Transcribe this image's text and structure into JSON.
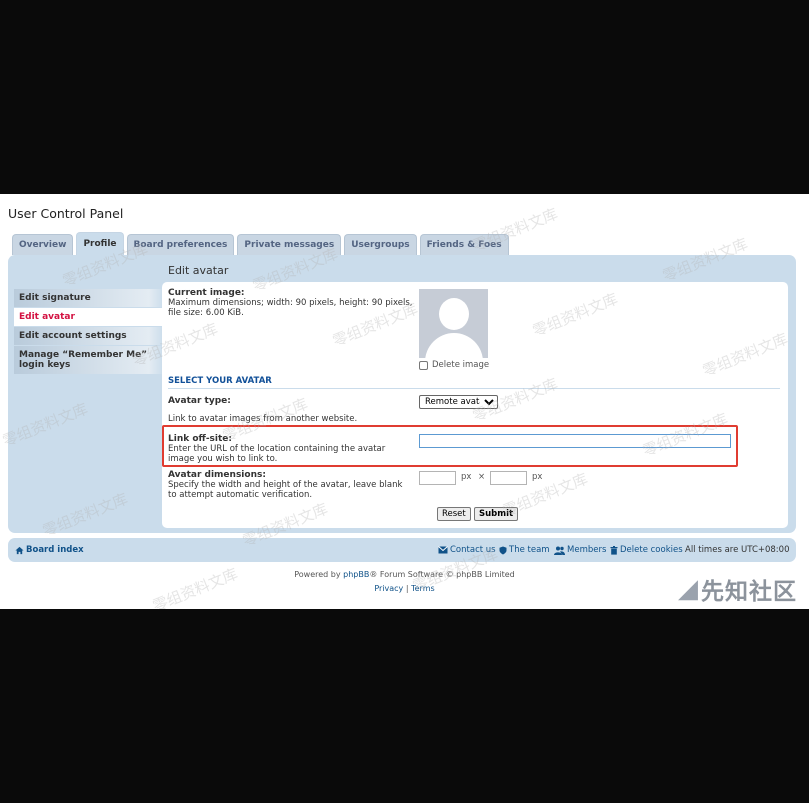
{
  "page": {
    "title": "User Control Panel"
  },
  "tabs": [
    {
      "label": "Overview"
    },
    {
      "label": "Profile",
      "active": true
    },
    {
      "label": "Board preferences"
    },
    {
      "label": "Private messages"
    },
    {
      "label": "Usergroups"
    },
    {
      "label": "Friends & Foes"
    }
  ],
  "sidebar": {
    "items": [
      {
        "label": "Edit signature"
      },
      {
        "label": "Edit avatar",
        "active": true
      },
      {
        "label": "Edit account settings"
      },
      {
        "label": "Manage “Remember Me” login keys"
      }
    ]
  },
  "content": {
    "title": "Edit avatar",
    "current_image_label": "Current image:",
    "current_image_explain": "Maximum dimensions; width: 90 pixels, height: 90 pixels, file size: 6.00 KiB.",
    "delete_image_label": "Delete image",
    "select_avatar_heading": "SELECT YOUR AVATAR",
    "avatar_type_label": "Avatar type:",
    "avatar_type_value": "Remote avatar",
    "remote_explain": "Link to avatar images from another website.",
    "link_label": "Link off-site:",
    "link_explain": "Enter the URL of the location containing the avatar image you wish to link to.",
    "link_value": "",
    "dimensions_label": "Avatar dimensions:",
    "dimensions_explain": "Specify the width and height of the avatar, leave blank to attempt automatic verification.",
    "px_unit": "px",
    "times_sign": "×",
    "reset_label": "Reset",
    "submit_label": "Submit"
  },
  "footer": {
    "board_index": "Board index",
    "contact_us": "Contact us",
    "the_team": "The team",
    "members": "Members",
    "delete_cookies": "Delete cookies",
    "timezone": "All times are UTC+08:00"
  },
  "credits": {
    "prefix": "Powered by ",
    "phpbb_link": "phpBB",
    "suffix": "® Forum Software © phpBB Limited",
    "privacy": "Privacy",
    "separator": "|",
    "terms": "Terms"
  },
  "watermark": {
    "text": "零组资料文库",
    "logo_text": "先知社区"
  },
  "colors": {
    "accent_red": "#d31141",
    "link_blue": "#105289",
    "panel_bg": "#cadceb",
    "highlight_box": "#e03c31"
  }
}
